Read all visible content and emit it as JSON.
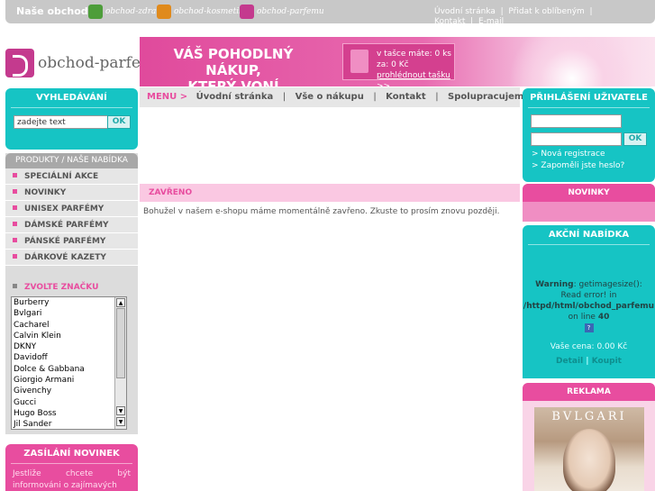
{
  "topbar": {
    "label": "Naše obchody:",
    "shops": [
      "obchod-zdravi",
      "obchod-kosmetiky",
      "obchod-parfemu"
    ],
    "links": [
      "Úvodní stránka",
      "Přidat k oblíbeným",
      "Kontakt",
      "E-mail"
    ]
  },
  "header": {
    "logo_text": "obchod-parfemu",
    "slogan_line1": "VÁŠ POHODLNÝ NÁKUP,",
    "slogan_line2": "KTERÝ VONÍ"
  },
  "cart": {
    "items_line": "v tašce máte: 0 ks",
    "total_line": "za: 0 Kč",
    "view_link": "prohlédnout tašku",
    "arrows": ">>"
  },
  "search": {
    "title": "VYHLEDÁVÁNÍ",
    "value": "zadejte text",
    "button": "OK"
  },
  "products": {
    "title": "PRODUKTY / NAŠE NABÍDKA",
    "items": [
      "SPECIÁLNÍ AKCE",
      "NOVINKY",
      "UNISEX PARFÉMY",
      "DÁMSKÉ PARFÉMY",
      "PÁNSKÉ PARFÉMY",
      "DÁRKOVÉ KAZETY"
    ]
  },
  "brands": {
    "title": "ZVOLTE ZNAČKU",
    "items": [
      "Burberry",
      "Bvlgari",
      "Cacharel",
      "Calvin Klein",
      "DKNY",
      "Davidoff",
      "Dolce & Gabbana",
      "Giorgio Armani",
      "Givenchy",
      "Gucci",
      "Hugo Boss",
      "Jil Sander"
    ]
  },
  "newsletter": {
    "title": "ZASÍLÁNÍ NOVINEK",
    "text": "Jestliže chcete být informováni o zajímavých"
  },
  "menu": {
    "label": "MENU >",
    "items": [
      "Úvodní stránka",
      "Vše o nákupu",
      "Kontakt",
      "Spolupracujeme"
    ]
  },
  "main": {
    "heading": "ZAVŘENO",
    "text": "Bohužel v našem e-shopu máme momentálně zavřeno. Zkuste to prosím znovu později."
  },
  "login": {
    "title": "PŘIHLÁŠENÍ UŽIVATELE",
    "button": "OK",
    "register": "> Nová registrace",
    "forgot": "> Zapoměli jste heslo?"
  },
  "novinky": {
    "title": "NOVINKY"
  },
  "akce": {
    "title": "AKČNÍ NABÍDKA",
    "warning_label": "Warning",
    "warning_text": ": getimagesize():",
    "warning_line2": "Read error! in",
    "warning_path": "/httpd/html/obchod_parfemu",
    "on_line": "on line",
    "line_no": "40",
    "broken_image_glyph": "?",
    "price": "Vaše cena: 0.00 Kč",
    "detail": "Detail",
    "buy": "Koupit"
  },
  "reklama": {
    "title": "REKLAMA",
    "ad_brand": "BVLGARI"
  },
  "colors": {
    "teal": "#16c4c4",
    "pink": "#e84d9f",
    "grey": "#c8c8c8"
  }
}
